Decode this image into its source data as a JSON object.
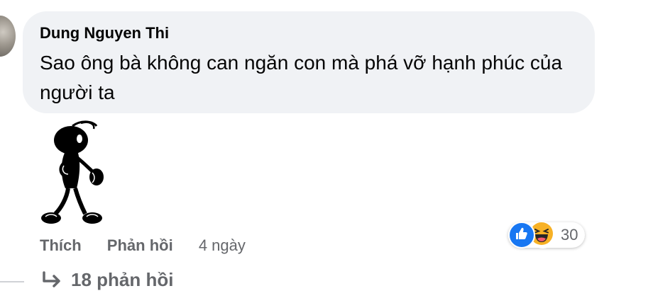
{
  "comment": {
    "author": "Dung Nguyen Thi",
    "text": "Sao ông bà không can ngăn con mà phá vỡ hạnh phúc của người ta",
    "sticker_icon": "black-stick-figure-sticker"
  },
  "actions": {
    "like_label": "Thích",
    "reply_label": "Phản hồi",
    "timestamp": "4 ngày"
  },
  "reactions": {
    "icons": [
      "like-icon",
      "haha-icon"
    ],
    "count": "30",
    "like_color": "#1877f2",
    "haha_color": "#f7b125"
  },
  "replies": {
    "label": "18 phản hồi",
    "icon": "reply-arrow-icon"
  },
  "colors": {
    "bubble_bg": "#f0f2f5",
    "secondary_text": "#65676b",
    "primary_text": "#050505"
  }
}
